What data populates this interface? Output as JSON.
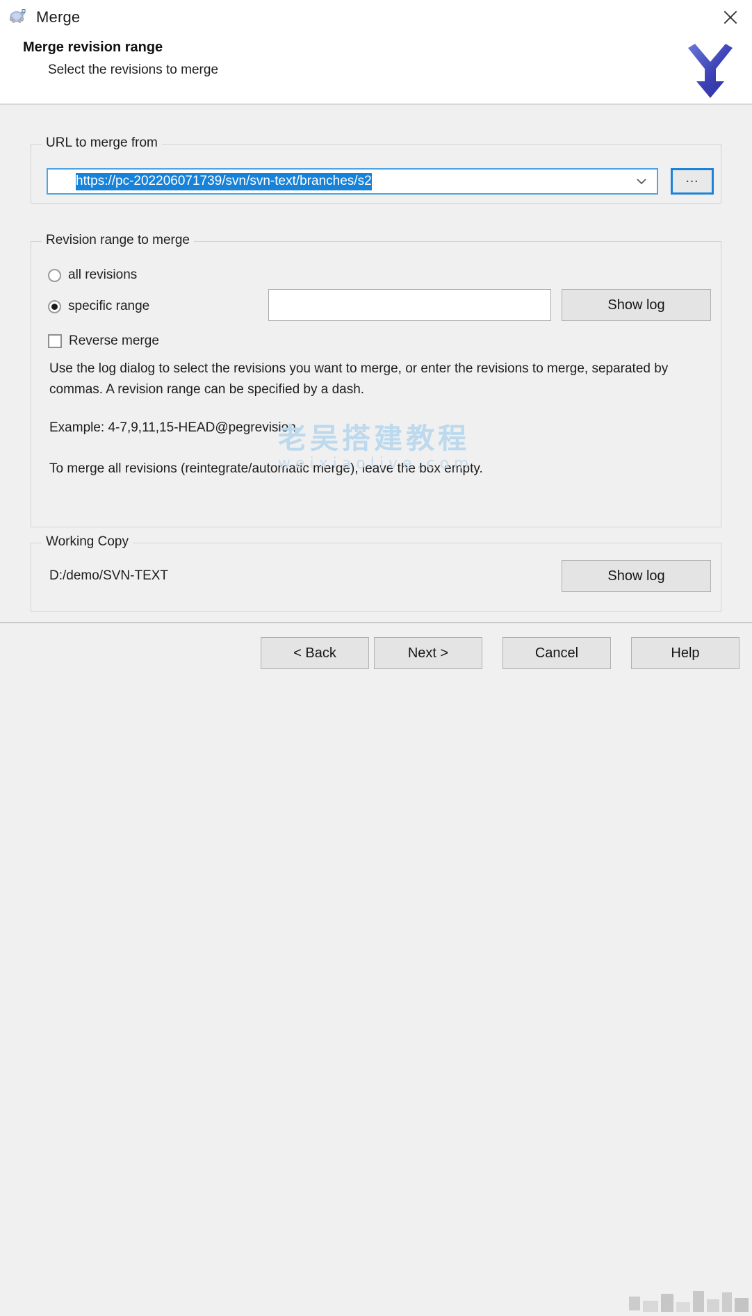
{
  "window": {
    "title": "Merge",
    "icon": "tortoise-icon",
    "close_label": "✕"
  },
  "header": {
    "title": "Merge revision range",
    "subtitle": "Select the revisions to merge",
    "logo": "merge-arrow-icon"
  },
  "url_group": {
    "legend": "URL to merge from",
    "url_value": "https://pc-202206071739/svn/svn-text/branches/s2",
    "url_selected": true,
    "dropdown_icon": "chevron-down-icon",
    "browse_label": "...",
    "selection_color": "#1882d8",
    "focus_border_color": "#1d82d8"
  },
  "revision_group": {
    "legend": "Revision range to merge",
    "options": [
      {
        "label": "all revisions",
        "checked": false
      },
      {
        "label": "specific range",
        "checked": true
      }
    ],
    "reverse_merge": {
      "label": "Reverse merge",
      "checked": false
    },
    "range_value": "",
    "show_log_label": "Show log",
    "help_line_1": "Use the log dialog to select the revisions you want to merge, or enter the revisions to merge, separated by commas. A revision range can be specified by a dash.",
    "help_line_2": "Example: 4-7,9,11,15-HEAD@pegrevision",
    "help_line_3": "To merge all revisions (reintegrate/automatic merge), leave the box empty."
  },
  "working_copy": {
    "legend": "Working Copy",
    "path": "D:/demo/SVN-TEXT",
    "show_log_label": "Show log"
  },
  "footer": {
    "back_label": "< Back",
    "next_label": "Next >",
    "cancel_label": "Cancel",
    "help_label": "Help"
  },
  "watermark": {
    "chinese": "老吴搭建教程",
    "site": "weixiaolive.com",
    "color": "#bcd9ee"
  }
}
